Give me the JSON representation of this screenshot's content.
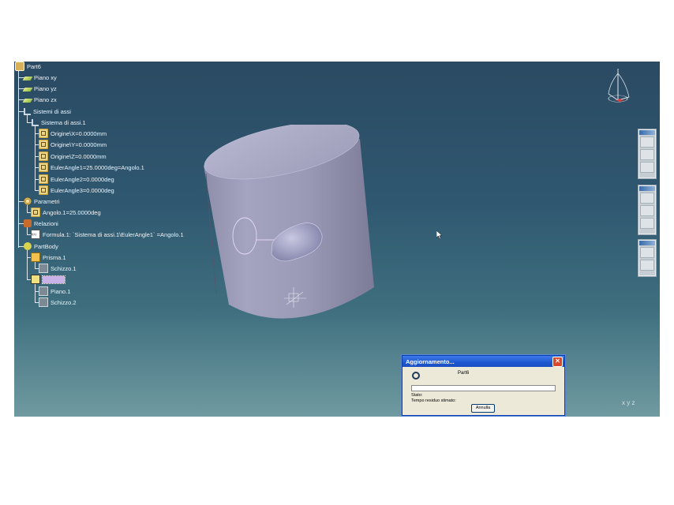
{
  "tree": {
    "root": "Part6",
    "planes": [
      "Piano xy",
      "Piano yz",
      "Piano zx"
    ],
    "axis_systems": "Sistemi di assi",
    "axis_system": "Sistema di assi.1",
    "axis_params": [
      "Origine\\X=0.0000mm",
      "Origine\\Y=0.0000mm",
      "Origine\\Z=0.0000mm",
      "EulerAngle1=25.0000deg=Angolo.1",
      "EulerAngle2=0.0000deg",
      "EulerAngle3=0.0000deg"
    ],
    "parameters": "Parametri",
    "parameter_item": "Angolo.1=25.0000deg",
    "relations": "Relazioni",
    "formula": "Formula.1: `Sistema di assi.1\\EulerAngle1` =Angolo.1",
    "part_body": "PartBody",
    "prism": "Prisma.1",
    "sketch1": "Schizzo.1",
    "pocket_selected": "Tasca.1",
    "plane1": "Piano.1",
    "sketch2": "Schizzo.2"
  },
  "dialog": {
    "title": "Aggiornamento...",
    "close": "✕",
    "part": "Part6",
    "stato": "Stato:",
    "tempo": "Tempo residuo stimato:",
    "cancel": "Annulla",
    "progress": 0
  },
  "viewport": {
    "axis_label": "x",
    "axis_label_y": "y",
    "axis_label_z": "z"
  },
  "colors": {
    "background_top": "#2b4a63",
    "background_bottom": "#6f9aa0",
    "solid": "#9a9ab8",
    "selection": "#c8b2e8"
  }
}
